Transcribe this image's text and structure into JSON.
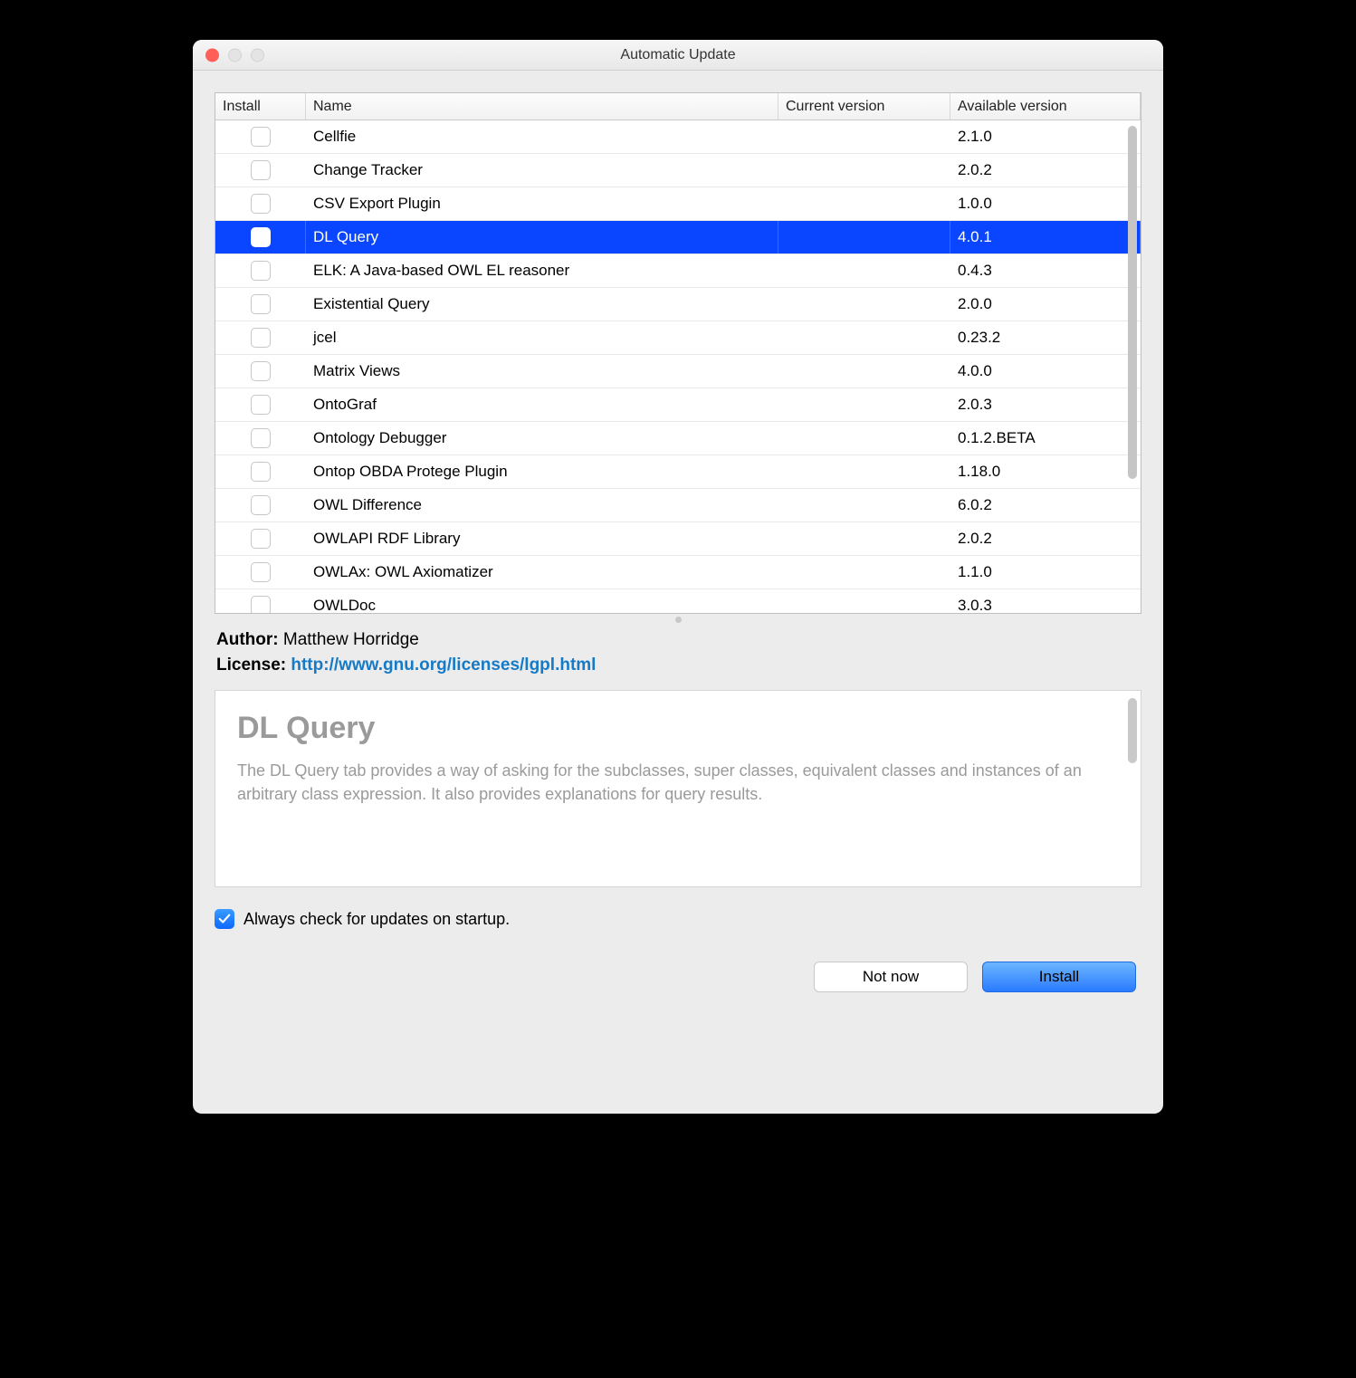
{
  "window": {
    "title": "Automatic Update"
  },
  "table": {
    "headers": {
      "install": "Install",
      "name": "Name",
      "current": "Current version",
      "available": "Available version"
    },
    "rows": [
      {
        "name": "Cellfie",
        "current": "",
        "available": "2.1.0",
        "selected": false
      },
      {
        "name": "Change Tracker",
        "current": "",
        "available": "2.0.2",
        "selected": false
      },
      {
        "name": "CSV Export Plugin",
        "current": "",
        "available": "1.0.0",
        "selected": false
      },
      {
        "name": "DL Query",
        "current": "",
        "available": "4.0.1",
        "selected": true
      },
      {
        "name": "ELK: A Java-based OWL EL reasoner",
        "current": "",
        "available": "0.4.3",
        "selected": false
      },
      {
        "name": "Existential Query",
        "current": "",
        "available": "2.0.0",
        "selected": false
      },
      {
        "name": "jcel",
        "current": "",
        "available": "0.23.2",
        "selected": false
      },
      {
        "name": "Matrix Views",
        "current": "",
        "available": "4.0.0",
        "selected": false
      },
      {
        "name": "OntoGraf",
        "current": "",
        "available": "2.0.3",
        "selected": false
      },
      {
        "name": "Ontology Debugger",
        "current": "",
        "available": "0.1.2.BETA",
        "selected": false
      },
      {
        "name": "Ontop OBDA Protege Plugin",
        "current": "",
        "available": "1.18.0",
        "selected": false
      },
      {
        "name": "OWL Difference",
        "current": "",
        "available": "6.0.2",
        "selected": false
      },
      {
        "name": "OWLAPI RDF Library",
        "current": "",
        "available": "2.0.2",
        "selected": false
      },
      {
        "name": "OWLAx: OWL Axiomatizer",
        "current": "",
        "available": "1.1.0",
        "selected": false
      },
      {
        "name": "OWLDoc",
        "current": "",
        "available": "3.0.3",
        "selected": false
      }
    ]
  },
  "meta": {
    "author_label": "Author:",
    "author": "Matthew Horridge",
    "license_label": "License:",
    "license_url": "http://www.gnu.org/licenses/lgpl.html"
  },
  "detail": {
    "title": "DL Query",
    "description": "The DL Query tab provides a way of asking for the subclasses, super classes, equivalent classes and instances of an arbitrary class expression. It also provides explanations for query results."
  },
  "startup": {
    "checked": true,
    "label": "Always check for updates on startup."
  },
  "buttons": {
    "not_now": "Not now",
    "install": "Install"
  }
}
